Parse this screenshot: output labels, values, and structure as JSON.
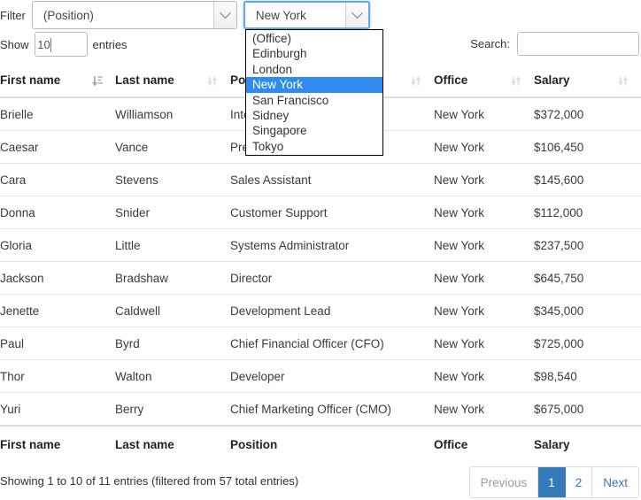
{
  "controls": {
    "filter_label": "Filter",
    "position_select": {
      "value": "(Position)",
      "icon": "chevron-down-icon"
    },
    "office_select": {
      "value": "New York",
      "icon": "chevron-down-icon"
    },
    "office_options": [
      "(Office)",
      "Edinburgh",
      "London",
      "New York",
      "San Francisco",
      "Sidney",
      "Singapore",
      "Tokyo"
    ],
    "office_selected": "New York",
    "show_label": "Show",
    "entries_label": "entries",
    "length_value": "10",
    "search_label": "Search:",
    "search_value": "",
    "search_placeholder": ""
  },
  "table": {
    "columns": [
      {
        "label": "First name",
        "sort": "sort-asc-icon"
      },
      {
        "label": "Last name",
        "sort": "sort-both-icon"
      },
      {
        "label": "Position",
        "sort": "sort-both-icon"
      },
      {
        "label": "Office",
        "sort": "sort-both-icon"
      },
      {
        "label": "Salary",
        "sort": "sort-both-icon"
      }
    ],
    "rows": [
      {
        "first": "Brielle",
        "last": "Williamson",
        "position": "Integration Specialist",
        "office": "New York",
        "salary": "$372,000"
      },
      {
        "first": "Caesar",
        "last": "Vance",
        "position": "Pre-Sales Support",
        "office": "New York",
        "salary": "$106,450"
      },
      {
        "first": "Cara",
        "last": "Stevens",
        "position": "Sales Assistant",
        "office": "New York",
        "salary": "$145,600"
      },
      {
        "first": "Donna",
        "last": "Snider",
        "position": "Customer Support",
        "office": "New York",
        "salary": "$112,000"
      },
      {
        "first": "Gloria",
        "last": "Little",
        "position": "Systems Administrator",
        "office": "New York",
        "salary": "$237,500"
      },
      {
        "first": "Jackson",
        "last": "Bradshaw",
        "position": "Director",
        "office": "New York",
        "salary": "$645,750"
      },
      {
        "first": "Jenette",
        "last": "Caldwell",
        "position": "Development Lead",
        "office": "New York",
        "salary": "$345,000"
      },
      {
        "first": "Paul",
        "last": "Byrd",
        "position": "Chief Financial Officer (CFO)",
        "office": "New York",
        "salary": "$725,000"
      },
      {
        "first": "Thor",
        "last": "Walton",
        "position": "Developer",
        "office": "New York",
        "salary": "$98,540"
      },
      {
        "first": "Yuri",
        "last": "Berry",
        "position": "Chief Marketing Officer (CMO)",
        "office": "New York",
        "salary": "$675,000"
      }
    ],
    "footer": [
      "First name",
      "Last name",
      "Position",
      "Office",
      "Salary"
    ]
  },
  "footer": {
    "info": "Showing 1 to 10 of 11 entries (filtered from 57 total entries)",
    "pagination": [
      {
        "label": "Previous",
        "state": "disabled"
      },
      {
        "label": "1",
        "state": "active"
      },
      {
        "label": "2",
        "state": "link"
      },
      {
        "label": "Next",
        "state": "link"
      }
    ]
  },
  "colors": {
    "accent": "#337ab7",
    "highlight": "#2f8bef",
    "focus_border": "#60a8e8"
  }
}
